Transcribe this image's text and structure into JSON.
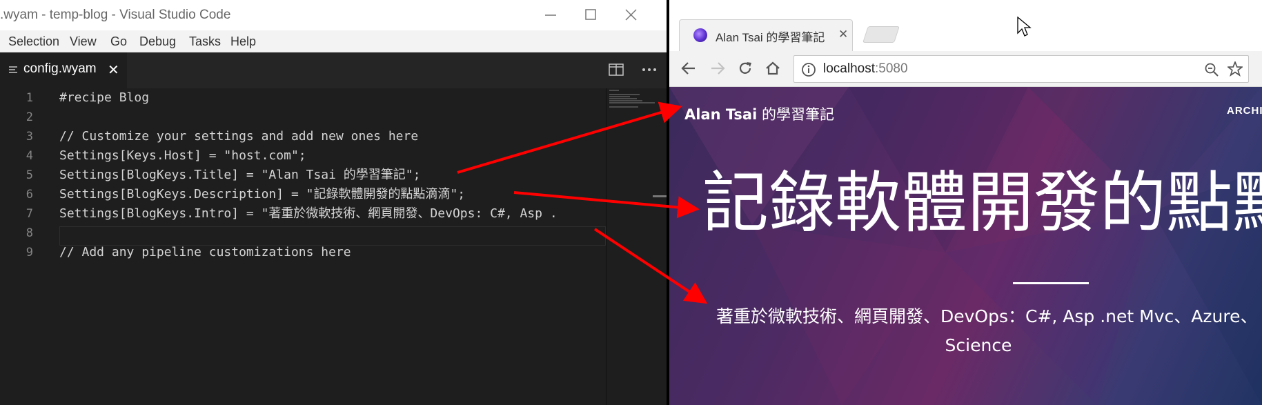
{
  "vscode": {
    "window_title": ".wyam - temp-blog - Visual Studio Code",
    "menu": [
      "Selection",
      "View",
      "Go",
      "Debug",
      "Tasks",
      "Help"
    ],
    "tab": {
      "label": "config.wyam",
      "close": "✕"
    },
    "code_lines": [
      {
        "num": "1",
        "text": "#recipe Blog"
      },
      {
        "num": "2",
        "text": ""
      },
      {
        "num": "3",
        "text": "// Customize your settings and add new ones here"
      },
      {
        "num": "4",
        "text": "Settings[Keys.Host] = \"host.com\";"
      },
      {
        "num": "5",
        "text": "Settings[BlogKeys.Title] = \"Alan Tsai 的學習筆記\";"
      },
      {
        "num": "6",
        "text": "Settings[BlogKeys.Description] = \"記錄軟體開發的點點滴滴\";"
      },
      {
        "num": "7",
        "text": "Settings[BlogKeys.Intro] = \"著重於微軟技術、網頁開發、DevOps: C#, Asp ."
      },
      {
        "num": "8",
        "text": ""
      },
      {
        "num": "9",
        "text": "// Add any pipeline customizations here"
      }
    ]
  },
  "chrome": {
    "tab_title": "Alan Tsai 的學習筆記",
    "tab_close": "✕",
    "url_host": "localhost",
    "url_port": ":5080",
    "page": {
      "site_title_latin": "Alan Tsai",
      "site_title_cjk": " 的學習筆記",
      "nav_archive": "ARCHIV",
      "hero_title": "記錄軟體開發的點點",
      "intro_line1": "著重於微軟技術、網頁開發、DevOps：C#, Asp .net Mvc、Azure、",
      "intro_line2": "Science"
    }
  },
  "colors": {
    "annotation_arrow": "#ff0000",
    "editor_bg": "#1e1e1e",
    "code_text": "#d4d4d4",
    "line_number": "#858585"
  },
  "icons": [
    "lines-icon",
    "close-icon",
    "split-editor-icon",
    "more-icon",
    "minimize-icon",
    "maximize-icon",
    "window-close-icon",
    "favicon-icon",
    "back-icon",
    "forward-icon",
    "reload-icon",
    "home-icon",
    "info-icon",
    "zoom-icon",
    "star-icon",
    "mouse-cursor-icon"
  ]
}
